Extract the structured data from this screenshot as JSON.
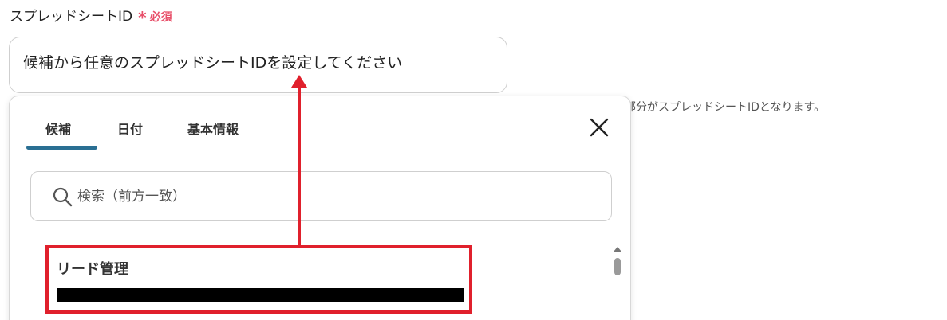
{
  "field": {
    "label": "スプレッドシートID",
    "required_mark": "*",
    "required_text": "必須"
  },
  "main_input": {
    "placeholder": "候補から任意のスプレッドシートIDを設定してください"
  },
  "hint": {
    "text": "部分がスプレッドシートIDとなります。"
  },
  "popup": {
    "tabs": [
      {
        "label": "候補",
        "active": true
      },
      {
        "label": "日付",
        "active": false
      },
      {
        "label": "基本情報",
        "active": false
      }
    ],
    "search": {
      "placeholder": "検索（前方一致）"
    },
    "items": [
      {
        "title": "リード管理"
      }
    ]
  },
  "colors": {
    "required": "#e8506a",
    "tab_indicator": "#2a6f93",
    "highlight": "#e0202c"
  },
  "icons": {
    "close": "close-icon",
    "search": "search-icon"
  }
}
